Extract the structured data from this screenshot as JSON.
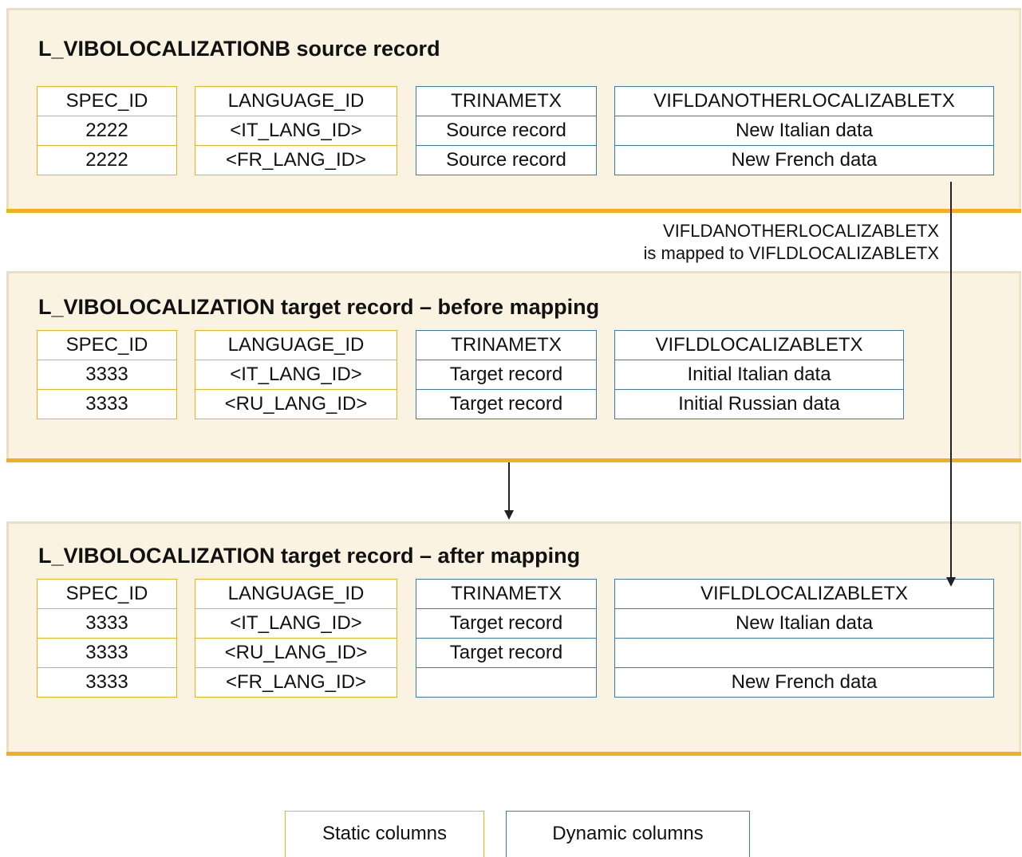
{
  "panels": [
    {
      "title": "L_VIBOLOCALIZATIONB source record",
      "columns": [
        {
          "kind": "static",
          "header": "SPEC_ID",
          "cells": [
            "2222",
            "2222"
          ]
        },
        {
          "kind": "static",
          "header": "LANGUAGE_ID",
          "cells": [
            "<IT_LANG_ID>",
            "<FR_LANG_ID>"
          ]
        },
        {
          "kind": "dynamic",
          "header": "TRINAMETX",
          "cells": [
            "Source record",
            "Source record"
          ]
        },
        {
          "kind": "dynamic",
          "header": "VIFLDANOTHERLOCALIZABLETX",
          "cells": [
            "New Italian data",
            "New French data"
          ]
        }
      ]
    },
    {
      "title": "L_VIBOLOCALIZATION target record – before mapping",
      "columns": [
        {
          "kind": "static",
          "header": "SPEC_ID",
          "cells": [
            "3333",
            "3333"
          ]
        },
        {
          "kind": "static",
          "header": "LANGUAGE_ID",
          "cells": [
            "<IT_LANG_ID>",
            "<RU_LANG_ID>"
          ]
        },
        {
          "kind": "dynamic",
          "header": "TRINAMETX",
          "cells": [
            "Target record",
            "Target record"
          ]
        },
        {
          "kind": "dynamic",
          "header": "VIFLDLOCALIZABLETX",
          "cells": [
            "Initial Italian data",
            "Initial Russian data"
          ]
        }
      ]
    },
    {
      "title": "L_VIBOLOCALIZATION target record – after mapping",
      "columns": [
        {
          "kind": "static",
          "header": "SPEC_ID",
          "cells": [
            "3333",
            "3333",
            "3333"
          ]
        },
        {
          "kind": "static",
          "header": "LANGUAGE_ID",
          "cells": [
            "<IT_LANG_ID>",
            "<RU_LANG_ID>",
            "<FR_LANG_ID>"
          ]
        },
        {
          "kind": "dynamic",
          "header": "TRINAMETX",
          "cells": [
            "Target record",
            "Target record",
            ""
          ]
        },
        {
          "kind": "dynamic",
          "header": "VIFLDLOCALIZABLETX",
          "cells": [
            "New Italian data",
            "",
            "New French data"
          ]
        }
      ]
    }
  ],
  "mapping_note": {
    "line1": "VIFLDANOTHERLOCALIZABLETX",
    "line2": "is mapped to VIFLDLOCALIZABLETX"
  },
  "legend": {
    "static": "Static columns",
    "dynamic": "Dynamic columns"
  },
  "colors": {
    "static_border": "#f2b01c",
    "dynamic_border": "#3a7ab8",
    "panel_background": "#faf3e2",
    "panel_underline": "#f2b01c"
  }
}
